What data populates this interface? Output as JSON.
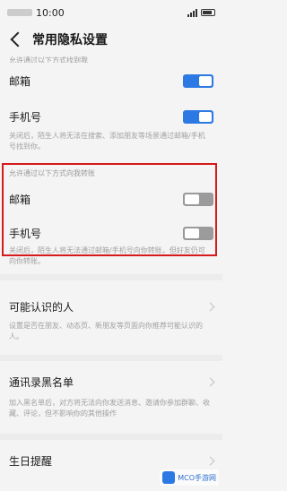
{
  "status_bar": {
    "time": "10:00"
  },
  "header": {
    "title": "常用隐私设置"
  },
  "section1": {
    "hint": "允许通过以下方式找到我",
    "items": [
      {
        "label": "邮箱",
        "on": true
      },
      {
        "label": "手机号",
        "on": true
      }
    ],
    "desc": "关闭后，陌生人将无法在搜索、添加朋友等场景通过邮箱/手机号找到你。"
  },
  "section2": {
    "hint": "允许通过以下方式向我转账",
    "items": [
      {
        "label": "邮箱",
        "on": false
      },
      {
        "label": "手机号",
        "on": false
      }
    ],
    "desc": "关闭后，陌生人将无法通过邮箱/手机号向你转账，但好友仍可向你转账。"
  },
  "nav": [
    {
      "label": "可能认识的人",
      "desc": "设置是否在朋友、动态页、新朋友等页面向你推荐可能认识的人。"
    },
    {
      "label": "通讯录黑名单",
      "desc": "加入黑名单后，对方将无法向你发送消息、邀请你参加群聊、收藏、评论，但不影响你的其他操作"
    },
    {
      "label": "生日提醒"
    }
  ],
  "watermark": {
    "text": "MCO手游网"
  }
}
